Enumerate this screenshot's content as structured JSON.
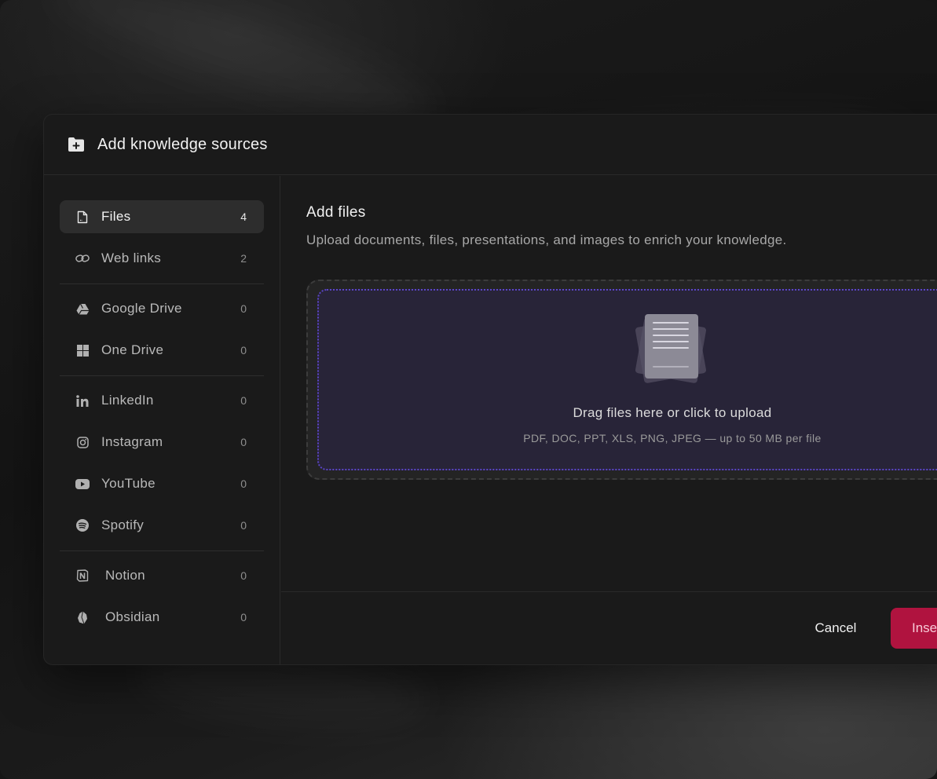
{
  "dialog": {
    "title": "Add knowledge sources",
    "header_icon": "folder-plus-icon"
  },
  "sidebar": {
    "items": [
      {
        "label": "Files",
        "count": "4",
        "icon": "file-icon",
        "active": true
      },
      {
        "label": "Web links",
        "count": "2",
        "icon": "link-icon"
      },
      {
        "label": "Google Drive",
        "count": "0",
        "icon": "google-drive-icon"
      },
      {
        "label": "One Drive",
        "count": "0",
        "icon": "windows-icon"
      },
      {
        "label": "LinkedIn",
        "count": "0",
        "icon": "linkedin-icon"
      },
      {
        "label": "Instagram",
        "count": "0",
        "icon": "instagram-icon"
      },
      {
        "label": "YouTube",
        "count": "0",
        "icon": "youtube-icon"
      },
      {
        "label": "Spotify",
        "count": "0",
        "icon": "spotify-icon"
      },
      {
        "label": "Notion",
        "count": "0",
        "icon": "notion-icon"
      },
      {
        "label": "Obsidian",
        "count": "0",
        "icon": "obsidian-icon"
      }
    ]
  },
  "main": {
    "title": "Add files",
    "description": "Upload documents, files, presentations, and images to enrich your knowledge.",
    "dropzone": {
      "title": "Drag files here or click to upload",
      "subtitle": "PDF, DOC, PPT, XLS, PNG, JPEG — up to 50 MB per file",
      "icon": "documents-stack-icon"
    }
  },
  "footer": {
    "cancel_label": "Cancel",
    "insert_label": "Insert"
  },
  "colors": {
    "accent": "#b0133f",
    "dropzone_border": "#5b45c8",
    "dropzone_fill": "#282438"
  }
}
